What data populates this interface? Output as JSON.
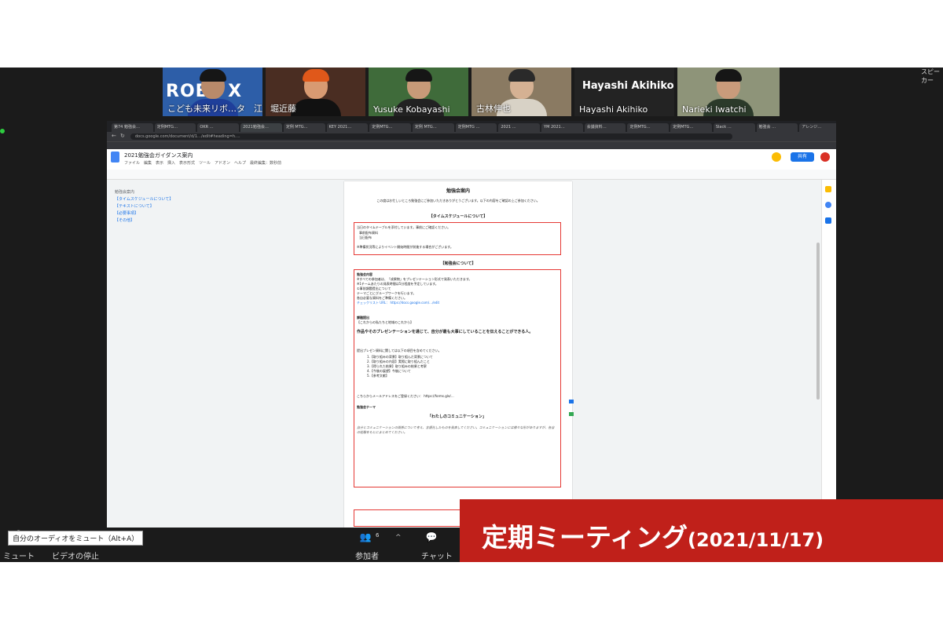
{
  "participants": [
    {
      "name": "こども未来リボ…タ　江川",
      "overlay": "ROBL X"
    },
    {
      "name": "堀近藤"
    },
    {
      "name": "Yusuke Kobayashi"
    },
    {
      "name": "古林伸也"
    },
    {
      "name": "Hayashi Akihiko",
      "heading": "Hayashi Akihiko"
    },
    {
      "name": "Narieki Iwatchi"
    }
  ],
  "browser": {
    "tabs": [
      "第74 勉強会…",
      "定例MTG…",
      "OKR …",
      "2021勉強会…",
      "定例 MTG…",
      "KEY 2021…",
      "定例MTG…",
      "定例 MTG…",
      "定例MTG …",
      "2021 …",
      "YM 2021…",
      "会議資料…",
      "定例MTG…",
      "定例MTG…",
      "Slack …",
      "勉強会 …",
      "アレンジ…"
    ],
    "url": "docs.google.com/document/d/1…/edit#heading=h.…"
  },
  "docs": {
    "title": "2021勉強会ガイダンス案内",
    "menu": "ファイル　編集　表示　挿入　表示形式　ツール　アドオン　ヘルプ　最終編集：数秒前",
    "share_label": "共有"
  },
  "outline": {
    "heading": "勉強会案内",
    "items": [
      "【タイムスケジュールについて】",
      "【テキストについて】",
      "【必要事項】",
      "【その他】"
    ]
  },
  "doc_page": {
    "title": "勉強会案内",
    "intro": "この度はお忙しいところ勉強会にご参加いただきありがとうございます。以下の内容をご確認の上ご参加ください。",
    "section1": "【タイムスケジュールについて】",
    "box1": [
      "当日のタイムテーブルを添付しています。事前にご確認ください。",
      "事前配布資料",
      "当日配布",
      "※準備状況等によりイベント開始時間が前後する場合がございます。"
    ],
    "section2": "【勉強会について】",
    "box2a": [
      "勉強会内容",
      "※すべての参加者は、「成果物」をプレゼンテーション形式で発表いただきます。",
      "※1チームあたりの発表時間は5分程度を予定しています。",
      "①事前課題提出について",
      "テーマごとにグループワークを行います。",
      "各自必要な資料をご準備ください。",
      "チェックリスト URL： https://docs.google.com/…/edit"
    ],
    "box2b": [
      "課題提出",
      "【これからの私たちと地域のこれから】",
      "作品やそのプレゼンテーションを通じて、自分が最も大事にしていることを伝えることができる人。"
    ],
    "box2c": [
      "提出プレゼン資料に関しては以下の項目を含めてください。",
      "1.【取り組みの背景】取り組んだ背景について",
      "2.【取り組みの内容】実際に取り組んだこと",
      "3.【得られた結果】取り組みの結果と考察",
      "4.【今後の展望】今後について",
      "5.【参考文献】"
    ],
    "box2d": [
      "こちらからメールアドレスをご登録ください： https://forms.gle/…",
      "勉強会テーマ",
      "「わたしのコミュニケーション」",
      "自分とコミュニケーションの関係について考え、言語化したものを発表してください。コミュニケーションには様々な形がありますが、各自の経験をもとにまとめてください。"
    ]
  },
  "controls": {
    "mute": "ミュート",
    "video": "ビデオの停止",
    "participants": "参加者",
    "participant_count": "6",
    "chat": "チャット",
    "tooltip": "自分のオーディオをミュート（Alt+A）"
  },
  "banner": {
    "title": "定期ミーティング",
    "date": "(2021/11/17)"
  },
  "speaker_view": "スピーカー",
  "colors": {
    "banner_red": "#c0201a",
    "zoom_bg": "#1b1b1b",
    "docs_blue": "#1a73e8"
  }
}
